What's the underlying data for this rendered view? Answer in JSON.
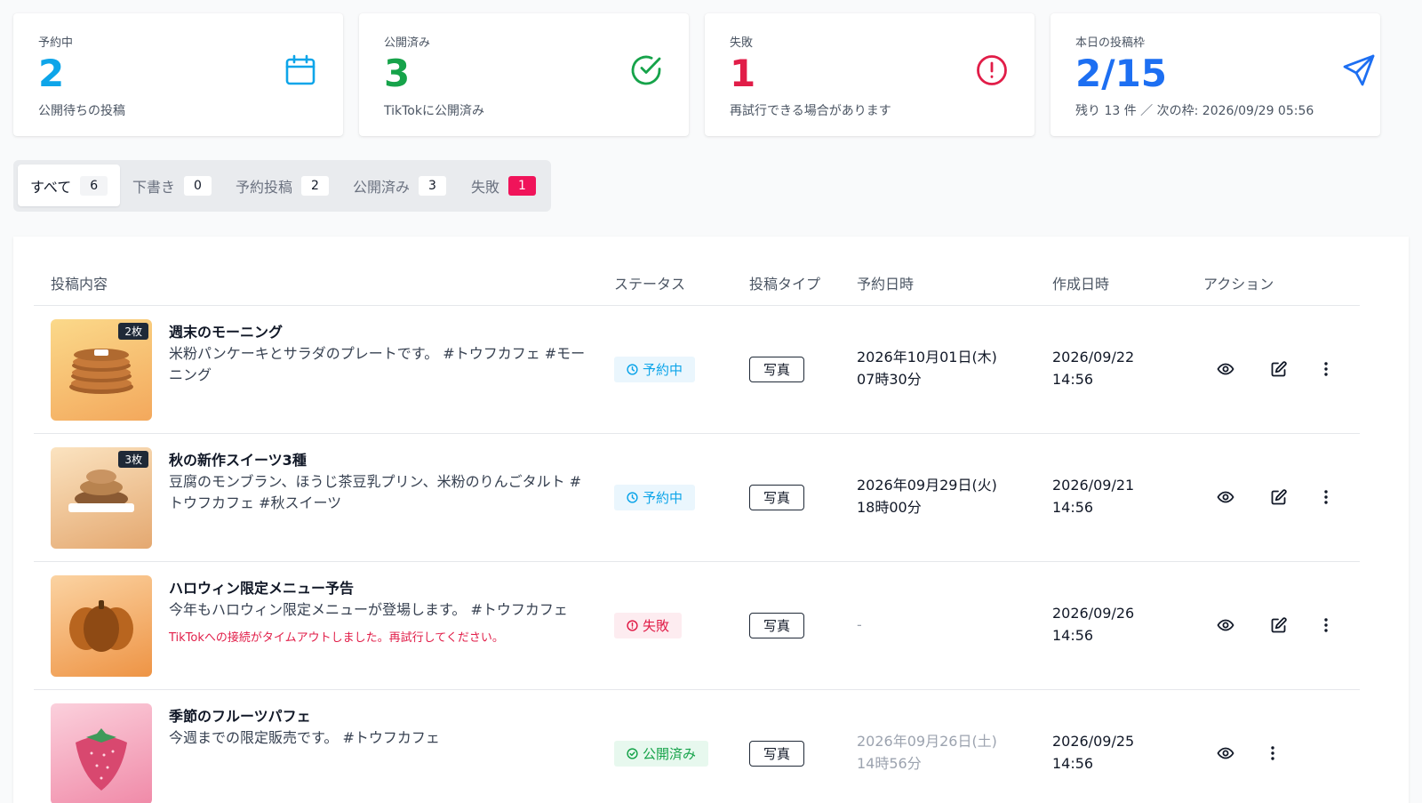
{
  "stats": [
    {
      "label": "予約中",
      "value": "2",
      "sub": "公開待ちの投稿",
      "icon": "calendar-icon",
      "color": "#0ea5e9"
    },
    {
      "label": "公開済み",
      "value": "3",
      "sub": "TikTokに公開済み",
      "icon": "check-circle-icon",
      "color": "#16a34a"
    },
    {
      "label": "失敗",
      "value": "1",
      "sub": "再試行できる場合があります",
      "icon": "alert-circle-icon",
      "color": "#e11d48"
    },
    {
      "label": "本日の投稿枠",
      "value": "2/15",
      "sub": "残り 13 件 ／ 次の枠: 2026/09/29 05:56",
      "icon": "send-icon",
      "color": "#1d6ff2"
    }
  ],
  "tabs": [
    {
      "label": "すべて",
      "count": "6",
      "active": true
    },
    {
      "label": "下書き",
      "count": "0"
    },
    {
      "label": "予約投稿",
      "count": "2"
    },
    {
      "label": "公開済み",
      "count": "3"
    },
    {
      "label": "失敗",
      "count": "1",
      "alert": true
    }
  ],
  "table": {
    "headers": {
      "content": "投稿内容",
      "status": "ステータス",
      "type": "投稿タイプ",
      "scheduled": "予約日時",
      "created": "作成日時",
      "actions": "アクション"
    },
    "rows": [
      {
        "media_count": "2枚",
        "thumb": "pancake",
        "title": "週末のモーニング",
        "desc": "米粉パンケーキとサラダのプレートです。 #トウフカフェ #モーニング",
        "error": "",
        "status": "予約中",
        "status_kind": "scheduled",
        "type": "写真",
        "scheduled_date": "2026年10月01日(木)",
        "scheduled_time": "07時30分",
        "created_date": "2026/09/22",
        "created_time": "14:56",
        "actions": [
          "eye-icon",
          "edit-icon",
          "more-vertical-icon"
        ]
      },
      {
        "media_count": "3枚",
        "thumb": "montblanc",
        "title": "秋の新作スイーツ3種",
        "desc": "豆腐のモンブラン、ほうじ茶豆乳プリン、米粉のりんごタルト #トウフカフェ #秋スイーツ",
        "error": "",
        "status": "予約中",
        "status_kind": "scheduled",
        "type": "写真",
        "scheduled_date": "2026年09月29日(火)",
        "scheduled_time": "18時00分",
        "created_date": "2026/09/21",
        "created_time": "14:56",
        "actions": [
          "eye-icon",
          "edit-icon",
          "more-vertical-icon"
        ]
      },
      {
        "media_count": "",
        "thumb": "pumpkin",
        "title": "ハロウィン限定メニュー予告",
        "desc": "今年もハロウィン限定メニューが登場します。 #トウフカフェ",
        "error": "TikTokへの接続がタイムアウトしました。再試行してください。",
        "status": "失敗",
        "status_kind": "failed",
        "type": "写真",
        "scheduled_date": "-",
        "scheduled_time": "",
        "created_date": "2026/09/26",
        "created_time": "14:56",
        "actions": [
          "eye-icon",
          "edit-icon",
          "more-vertical-icon"
        ]
      },
      {
        "media_count": "",
        "thumb": "strawberry",
        "title": "季節のフルーツパフェ",
        "desc": "今週までの限定販売です。 #トウフカフェ",
        "error": "",
        "status": "公開済み",
        "status_kind": "published",
        "type": "写真",
        "scheduled_date": "2026年09月26日(土)",
        "scheduled_time": "14時56分",
        "created_date": "2026/09/25",
        "created_time": "14:56",
        "actions": [
          "eye-icon",
          "more-vertical-icon"
        ]
      }
    ]
  }
}
